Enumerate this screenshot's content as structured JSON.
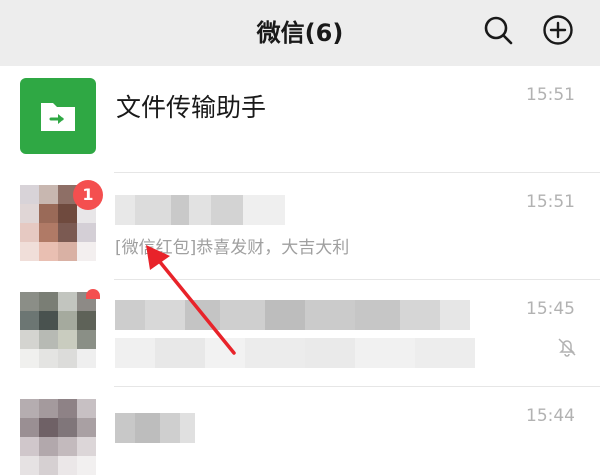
{
  "header": {
    "title": "微信(6)",
    "search_icon": "search-icon",
    "add_icon": "plus-circle-icon"
  },
  "chats": [
    {
      "name": "文件传输助手",
      "time": "15:51",
      "avatar_icon": "file-transfer-icon",
      "avatar_color": "#2fa844"
    },
    {
      "name": "",
      "time": "15:51",
      "preview": "[微信红包]恭喜发财，大吉大利",
      "unread_badge": "1",
      "avatar_icon": "blurred-avatar"
    },
    {
      "name": "",
      "time": "15:45",
      "muted_icon": "bell-off-icon",
      "avatar_icon": "blurred-avatar"
    },
    {
      "name": "",
      "time": "15:44",
      "avatar_icon": "blurred-avatar"
    }
  ],
  "annotation": {
    "arrow_color": "#e8232a"
  },
  "colors": {
    "header_bg": "#ededed",
    "badge": "#f44f4f",
    "accent_green": "#2fa844"
  }
}
